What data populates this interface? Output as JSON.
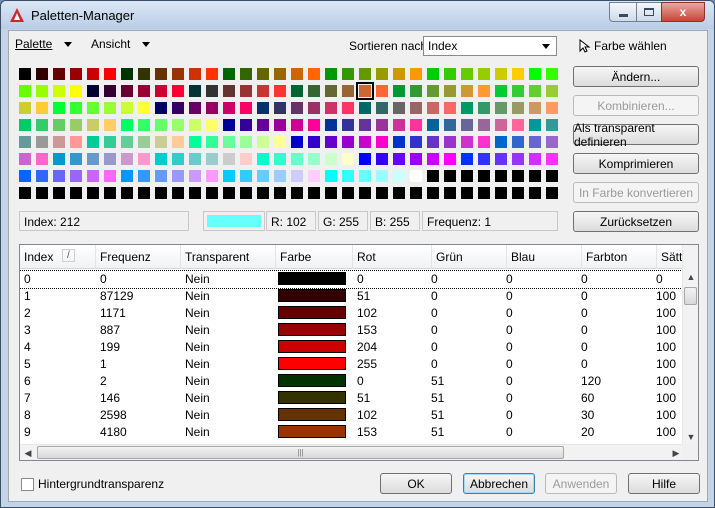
{
  "window": {
    "title": "Paletten-Manager",
    "minimize_icon": "minimize-icon",
    "maximize_icon": "maximize-icon",
    "close_icon": "close-icon",
    "close_glyph": "x"
  },
  "toolbar": {
    "palette_menu": "Palette",
    "view_menu": "Ansicht",
    "sort_label": "Sortieren nach:",
    "sort_value": "Index",
    "pick_color": "Farbe wählen"
  },
  "swatches": {
    "rows": [
      [
        "#000000",
        "#330000",
        "#660000",
        "#990000",
        "#cc0000",
        "#ff0000",
        "#003300",
        "#333300",
        "#663300",
        "#993300",
        "#cc3300",
        "#ff3300",
        "#006600",
        "#336600",
        "#666600",
        "#996600",
        "#cc6600",
        "#ff6600",
        "#009900",
        "#339900",
        "#669900",
        "#999900",
        "#cc9900",
        "#ff9900",
        "#00cc00",
        "#33cc00",
        "#66cc00",
        "#99cc00",
        "#cccc00",
        "#ffcc00",
        "#00ff00",
        "#33ff00"
      ],
      [
        "#66ff00",
        "#99ff00",
        "#ccff00",
        "#ffff00",
        "#000033",
        "#330033",
        "#660033",
        "#990033",
        "#cc0033",
        "#ff0033",
        "#003333",
        "#333333",
        "#663333",
        "#993333",
        "#cc3333",
        "#ff3333",
        "#006633",
        "#336633",
        "#666633",
        "#996633",
        "#cc6633",
        "#ff6633",
        "#009933",
        "#339933",
        "#669933",
        "#999933",
        "#cc9933",
        "#ff9933",
        "#00cc33",
        "#33cc33",
        "#66cc33",
        "#99cc33"
      ],
      [
        "#cccc33",
        "#ffcc33",
        "#00ff33",
        "#33ff33",
        "#66ff33",
        "#99ff33",
        "#ccff33",
        "#ffff33",
        "#000066",
        "#330066",
        "#660066",
        "#990066",
        "#cc0066",
        "#ff0066",
        "#003366",
        "#333366",
        "#663366",
        "#993366",
        "#cc3366",
        "#ff3366",
        "#006666",
        "#336666",
        "#666666",
        "#996666",
        "#cc6666",
        "#ff6666",
        "#009966",
        "#339966",
        "#669966",
        "#999966",
        "#cc9966",
        "#ff9966"
      ],
      [
        "#00cc66",
        "#33cc66",
        "#66cc66",
        "#99cc66",
        "#cccc66",
        "#ffcc66",
        "#00ff66",
        "#33ff66",
        "#66ff66",
        "#99ff66",
        "#ccff66",
        "#ffff66",
        "#000099",
        "#330099",
        "#660099",
        "#990099",
        "#cc0099",
        "#ff0099",
        "#003399",
        "#333399",
        "#663399",
        "#993399",
        "#cc3399",
        "#ff3399",
        "#006699",
        "#336699",
        "#666699",
        "#996699",
        "#cc6699",
        "#ff6699",
        "#009999",
        "#339999"
      ],
      [
        "#669999",
        "#999999",
        "#cc9999",
        "#ff9999",
        "#00cc99",
        "#33cc99",
        "#66cc99",
        "#99cc99",
        "#cccc99",
        "#ffcc99",
        "#00ff99",
        "#33ff99",
        "#66ff99",
        "#99ff99",
        "#ccff99",
        "#ffff99",
        "#0000cc",
        "#3300cc",
        "#6600cc",
        "#9900cc",
        "#cc00cc",
        "#ff00cc",
        "#0033cc",
        "#3333cc",
        "#6633cc",
        "#9933cc",
        "#cc33cc",
        "#ff33cc",
        "#0066cc",
        "#3366cc",
        "#6666cc",
        "#9966cc"
      ],
      [
        "#cc66cc",
        "#ff66cc",
        "#0099cc",
        "#3399cc",
        "#6699cc",
        "#9999cc",
        "#cc99cc",
        "#ff99cc",
        "#00cccc",
        "#33cccc",
        "#66cccc",
        "#99cccc",
        "#cccccc",
        "#ffcccc",
        "#00ffcc",
        "#33ffcc",
        "#66ffcc",
        "#99ffcc",
        "#ccffcc",
        "#ffffcc",
        "#0000ff",
        "#3300ff",
        "#6600ff",
        "#9900ff",
        "#cc00ff",
        "#ff00ff",
        "#0033ff",
        "#3333ff",
        "#6633ff",
        "#9933ff",
        "#cc33ff",
        "#ff33ff"
      ],
      [
        "#0066ff",
        "#3366ff",
        "#6666ff",
        "#9966ff",
        "#cc66ff",
        "#ff66ff",
        "#0099ff",
        "#3399ff",
        "#6699ff",
        "#9999ff",
        "#cc99ff",
        "#ff99ff",
        "#00ccff",
        "#33ccff",
        "#66ccff",
        "#99ccff",
        "#ccccff",
        "#ffccff",
        "#00ffff",
        "#33ffff",
        "#66ffff",
        "#99ffff",
        "#ccffff",
        "#ffffff",
        "#000000",
        "#000000",
        "#000000",
        "#000000",
        "#000000",
        "#000000",
        "#000000",
        "#000000"
      ],
      [
        "#000000",
        "#000000",
        "#000000",
        "#000000",
        "#000000",
        "#000000",
        "#000000",
        "#000000",
        "#000000",
        "#000000",
        "#000000",
        "#000000",
        "#000000",
        "#000000",
        "#000000",
        "#000000",
        "#000000",
        "#000000",
        "#000000",
        "#000000",
        "#000000",
        "#000000",
        "#000000",
        "#000000",
        "#000000",
        "#000000",
        "#000000",
        "#000000",
        "#000000",
        "#000000",
        "#000000",
        "#000000"
      ]
    ],
    "selected": {
      "row": 1,
      "col": 20
    }
  },
  "buttons": {
    "change": "Ändern...",
    "combine": "Kombinieren...",
    "set_transparent": "Als transparent definieren",
    "compress": "Komprimieren",
    "convert": "In Farbe konvertieren",
    "reset": "Zurücksetzen"
  },
  "info": {
    "index": "Index: 212",
    "preview_color": "#66ffff",
    "r": "R: 102",
    "g": "G: 255",
    "b": "B: 255",
    "frequency": "Frequenz: 1"
  },
  "table": {
    "columns": [
      "Index",
      "Frequenz",
      "Transparent",
      "Farbe",
      "Rot",
      "Grün",
      "Blau",
      "Farbton",
      "Sättig"
    ],
    "sort_indicator": "/",
    "rows": [
      {
        "index": "0",
        "freq": "0",
        "transp": "Nein",
        "color": "#000000",
        "r": "0",
        "g": "0",
        "b": "0",
        "hue": "0",
        "sat": "0"
      },
      {
        "index": "1",
        "freq": "87129",
        "transp": "Nein",
        "color": "#330000",
        "r": "51",
        "g": "0",
        "b": "0",
        "hue": "0",
        "sat": "100"
      },
      {
        "index": "2",
        "freq": "1171",
        "transp": "Nein",
        "color": "#660000",
        "r": "102",
        "g": "0",
        "b": "0",
        "hue": "0",
        "sat": "100"
      },
      {
        "index": "3",
        "freq": "887",
        "transp": "Nein",
        "color": "#990000",
        "r": "153",
        "g": "0",
        "b": "0",
        "hue": "0",
        "sat": "100"
      },
      {
        "index": "4",
        "freq": "199",
        "transp": "Nein",
        "color": "#cc0000",
        "r": "204",
        "g": "0",
        "b": "0",
        "hue": "0",
        "sat": "100"
      },
      {
        "index": "5",
        "freq": "1",
        "transp": "Nein",
        "color": "#ff0000",
        "r": "255",
        "g": "0",
        "b": "0",
        "hue": "0",
        "sat": "100"
      },
      {
        "index": "6",
        "freq": "2",
        "transp": "Nein",
        "color": "#003300",
        "r": "0",
        "g": "51",
        "b": "0",
        "hue": "120",
        "sat": "100"
      },
      {
        "index": "7",
        "freq": "146",
        "transp": "Nein",
        "color": "#333300",
        "r": "51",
        "g": "51",
        "b": "0",
        "hue": "60",
        "sat": "100"
      },
      {
        "index": "8",
        "freq": "2598",
        "transp": "Nein",
        "color": "#663300",
        "r": "102",
        "g": "51",
        "b": "0",
        "hue": "30",
        "sat": "100"
      },
      {
        "index": "9",
        "freq": "4180",
        "transp": "Nein",
        "color": "#993300",
        "r": "153",
        "g": "51",
        "b": "0",
        "hue": "20",
        "sat": "100"
      }
    ],
    "hscroll_grip": "|||"
  },
  "footer": {
    "bg_transparency": "Hintergrundtransparenz",
    "ok": "OK",
    "cancel": "Abbrechen",
    "apply": "Anwenden",
    "help": "Hilfe"
  }
}
